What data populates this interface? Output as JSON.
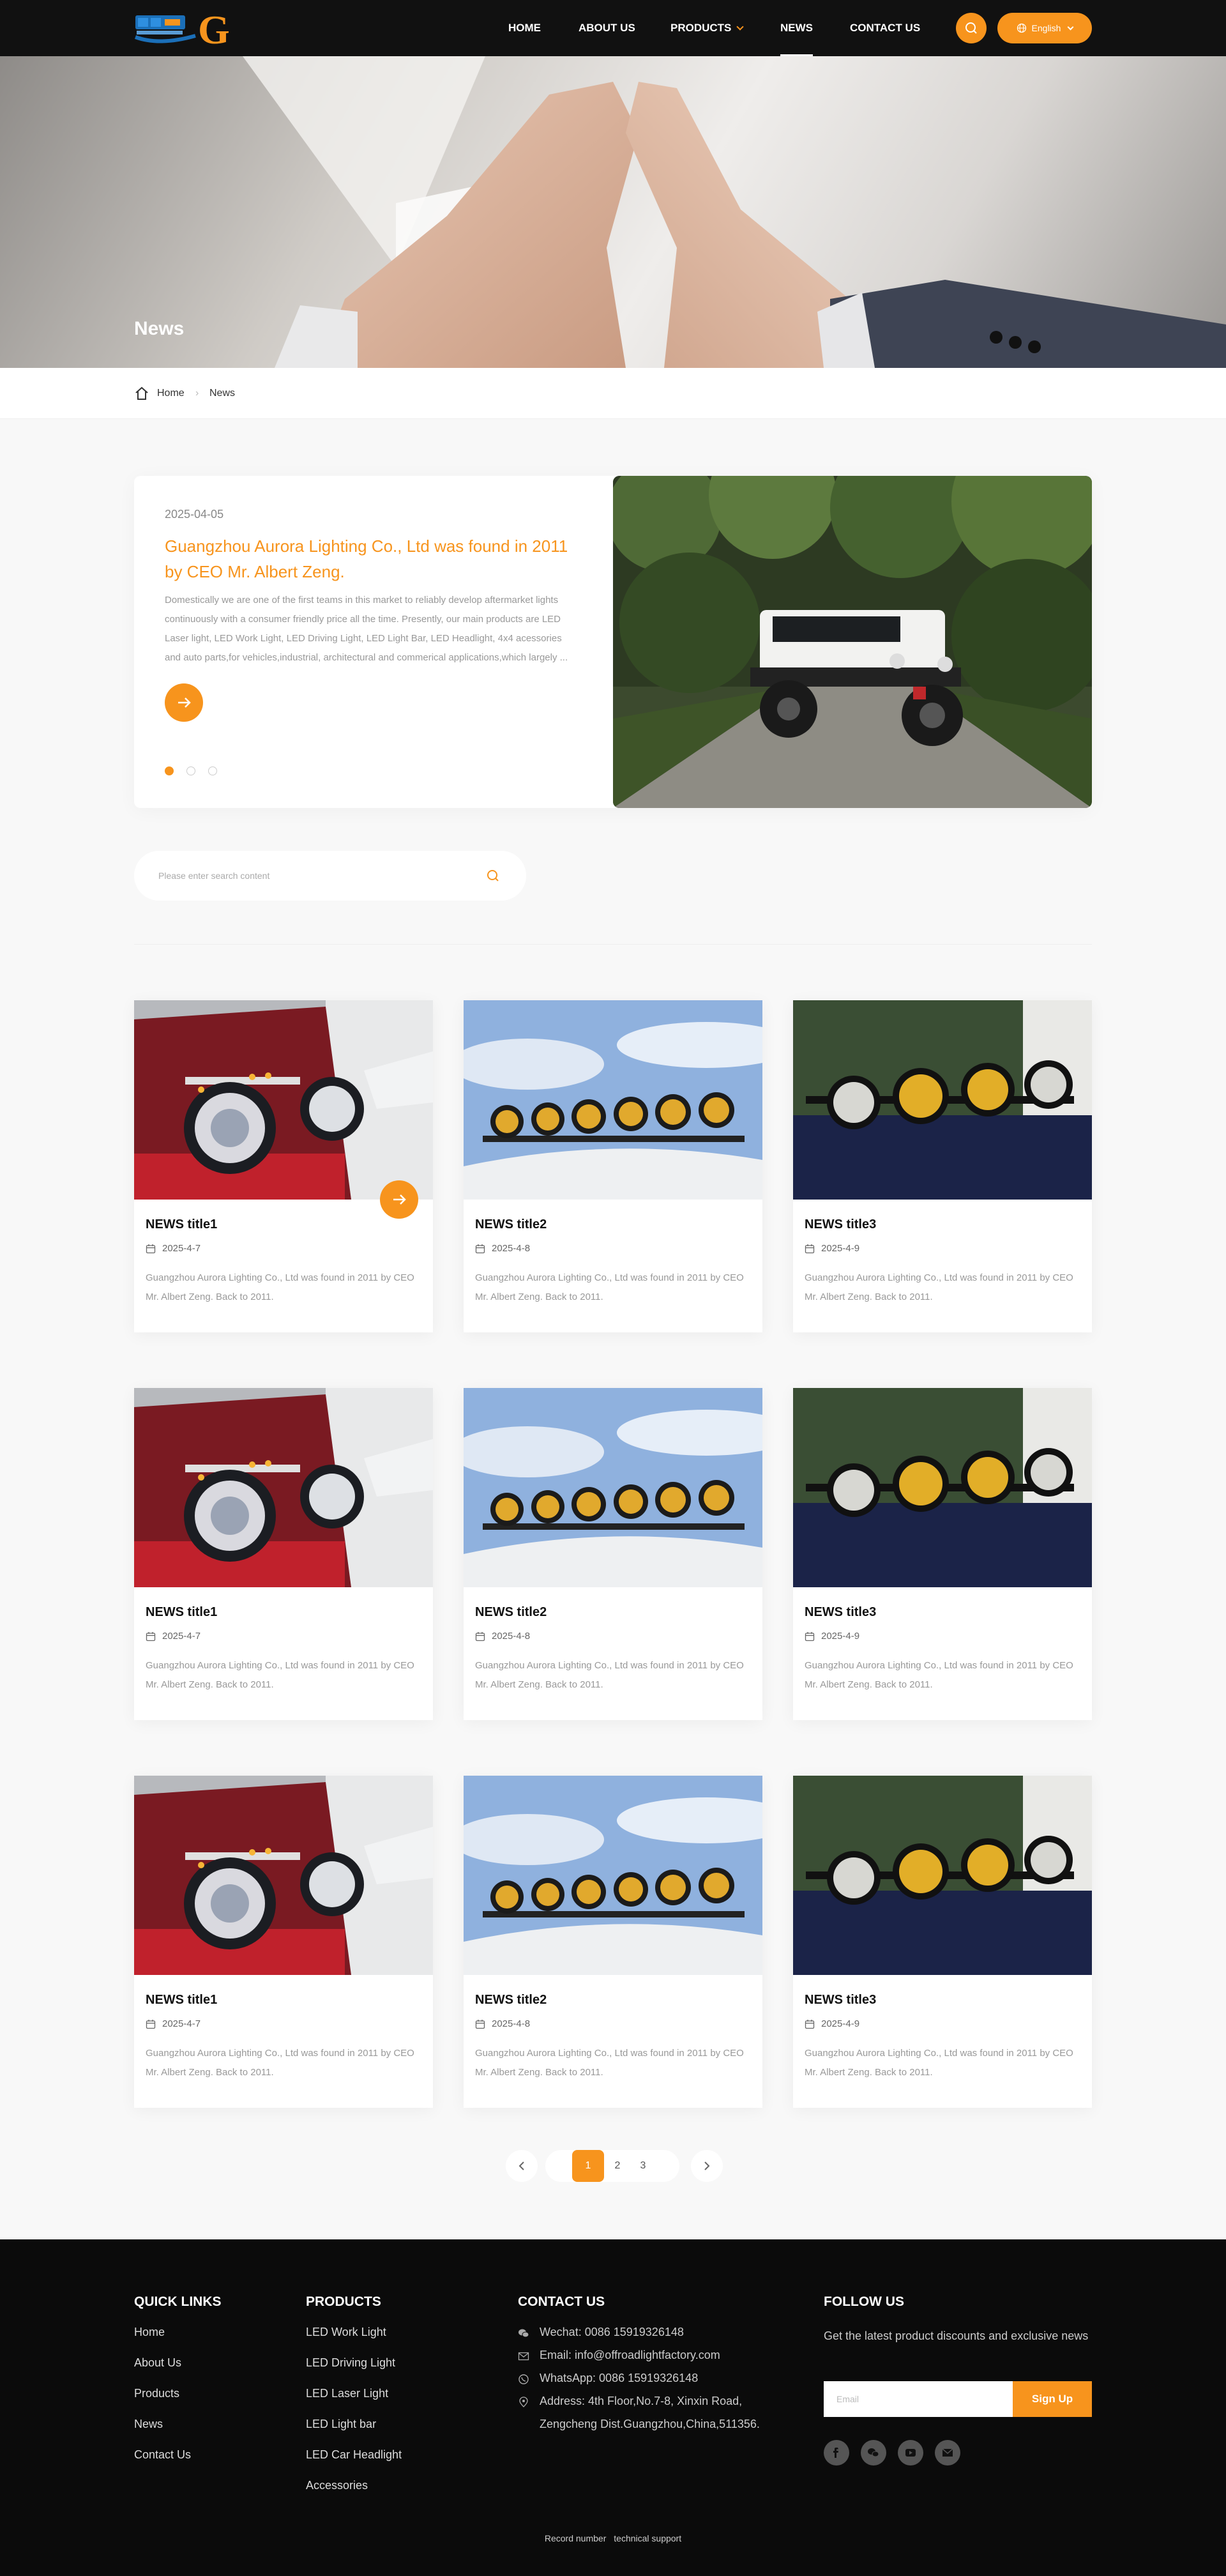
{
  "header": {
    "logo_text": "G",
    "nav": [
      {
        "label": "HOME"
      },
      {
        "label": "ABOUT US"
      },
      {
        "label": "PRODUCTS"
      },
      {
        "label": "NEWS"
      },
      {
        "label": "CONTACT US"
      }
    ],
    "active_nav": "NEWS",
    "language": "English"
  },
  "hero": {
    "title": "News"
  },
  "breadcrumb": {
    "home": "Home",
    "current": "News"
  },
  "featured": {
    "date": "2025-04-05",
    "title": "Guangzhou Aurora Lighting Co., Ltd was found in 2011 by CEO Mr. Albert Zeng.",
    "description": "Domestically we are one of the first teams in this market to reliably develop aftermarket lights continuously with a consumer friendly price all the time. Presently, our main products are LED Laser light, LED Work Light, LED Driving Light, LED Light Bar, LED Headlight, 4x4 acessories and auto parts,for vehicles,industrial, architectural and commerical applications,which largely ...",
    "slides": 3,
    "active_slide": 1
  },
  "search": {
    "placeholder": "Please enter search content"
  },
  "news": [
    {
      "title": "NEWS title1",
      "date": "2025-4-7",
      "desc": "Guangzhou Aurora Lighting Co., Ltd was found in 2011 by CEO Mr. Albert Zeng. Back to 2011."
    },
    {
      "title": "NEWS title2",
      "date": "2025-4-8",
      "desc": "Guangzhou Aurora Lighting Co., Ltd was found in 2011 by CEO Mr. Albert Zeng. Back to 2011."
    },
    {
      "title": "NEWS title3",
      "date": "2025-4-9",
      "desc": "Guangzhou Aurora Lighting Co., Ltd was found in 2011 by CEO Mr. Albert Zeng. Back to 2011."
    },
    {
      "title": "NEWS title1",
      "date": "2025-4-7",
      "desc": "Guangzhou Aurora Lighting Co., Ltd was found in 2011 by CEO Mr. Albert Zeng. Back to 2011."
    },
    {
      "title": "NEWS title2",
      "date": "2025-4-8",
      "desc": "Guangzhou Aurora Lighting Co., Ltd was found in 2011 by CEO Mr. Albert Zeng. Back to 2011."
    },
    {
      "title": "NEWS title3",
      "date": "2025-4-9",
      "desc": "Guangzhou Aurora Lighting Co., Ltd was found in 2011 by CEO Mr. Albert Zeng. Back to 2011."
    },
    {
      "title": "NEWS title1",
      "date": "2025-4-7",
      "desc": "Guangzhou Aurora Lighting Co., Ltd was found in 2011 by CEO Mr. Albert Zeng. Back to 2011."
    },
    {
      "title": "NEWS title2",
      "date": "2025-4-8",
      "desc": "Guangzhou Aurora Lighting Co., Ltd was found in 2011 by CEO Mr. Albert Zeng. Back to 2011."
    },
    {
      "title": "NEWS title3",
      "date": "2025-4-9",
      "desc": "Guangzhou Aurora Lighting Co., Ltd was found in 2011 by CEO Mr. Albert Zeng. Back to 2011."
    }
  ],
  "pagination": {
    "pages": [
      "1",
      "2",
      "3"
    ],
    "current": "1"
  },
  "footer": {
    "quick_links": {
      "heading": "QUICK LINKS",
      "items": [
        "Home",
        "About Us",
        "Products",
        "News",
        "Contact Us"
      ]
    },
    "products": {
      "heading": "PRODUCTS",
      "items": [
        "LED Work Light",
        "LED Driving Light",
        "LED Laser Light",
        "LED Light bar",
        "LED Car Headlight",
        "Accessories"
      ]
    },
    "contact": {
      "heading": "CONTACT US",
      "wechat": "Wechat: 0086 15919326148",
      "email": "Email: info@offroadlightfactory.com",
      "whatsapp": "WhatsApp: 0086 15919326148",
      "address_line1": "Address: 4th Floor,No.7-8, Xinxin Road,",
      "address_line2": "Zengcheng Dist.Guangzhou,China,511356."
    },
    "follow": {
      "heading": "FOLLOW US",
      "tagline": "Get the latest product discounts and exclusive news",
      "email_placeholder": "Email",
      "signup": "Sign Up",
      "socials": [
        "facebook-icon",
        "wechat-icon",
        "youtube-icon",
        "email-icon"
      ]
    },
    "bottom": {
      "record": "Record number",
      "support": "technical support"
    }
  },
  "colors": {
    "accent": "#f7941d",
    "header_bg": "#111111",
    "footer_bg": "#0b0b0b",
    "page_bg": "#f8f8f8"
  }
}
